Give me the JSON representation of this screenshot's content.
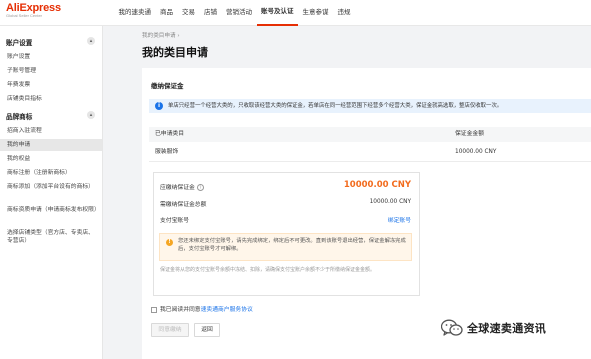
{
  "brand": {
    "name": "AliExpress",
    "sub": "Global Seller Center"
  },
  "nav": [
    "我的速卖通",
    "商品",
    "交易",
    "店铺",
    "营销活动",
    "账号及认证",
    "生意参谋",
    "违规"
  ],
  "sidebar": {
    "sections": [
      {
        "title": "账户设置",
        "items": [
          "账户设置",
          "子账号管理",
          "年费发票",
          "店铺类目指标"
        ]
      },
      {
        "title": "品牌商标",
        "items": [
          "招商入驻流程",
          "我的申请",
          "我的权益",
          "商标注册（注册新商标）",
          "商标添加（添加平台设有的商标）",
          "商标资质申请（申请商标发布权限）",
          "选择店铺类型（官方店、专卖店、专营店）"
        ]
      }
    ],
    "active_item": "我的申请"
  },
  "breadcrumb": "我的类目申请",
  "page_title": "我的类目申请",
  "deposit": {
    "section_title": "缴纳保证金",
    "info": "单店只经营一个经营大类的，只收取该经营大类的保证金，若单店在同一经营范围下经营多个经营大类，保证金就高选取，整店仅收取一次。",
    "table": {
      "headers": [
        "已申请类目",
        "保证金金额"
      ],
      "rows": [
        {
          "category": "服装服饰",
          "amount": "10000.00  CNY"
        }
      ]
    },
    "payment": {
      "label_due": "应缴纳保证金",
      "amount_due": "10000.00 CNY",
      "label_freeze": "需缴纳保证金总额",
      "freeze_value": "10000.00 CNY",
      "label_account": "支付宝账号",
      "account_link": "绑定账号",
      "warning": "您还未绑定支付宝账号，请先完成绑定，绑定后不可更改。直到该账号退出经营，保证金解冻完成后，支付宝账号才可解绑。",
      "note": "保证金将从您的支付宝账号余额中冻结、扣除，请确保支付宝账户余额不少于所缴纳保证金金额。"
    },
    "agree_text": "我已阅读并同意",
    "agree_link": "速卖通商户服务协议",
    "submit_label": "同意缴纳",
    "back_label": "返回"
  },
  "watermark": "全球速卖通资讯",
  "colors": {
    "accent": "#e62e04",
    "orange": "#f26b1d",
    "link": "#1a73e8"
  }
}
